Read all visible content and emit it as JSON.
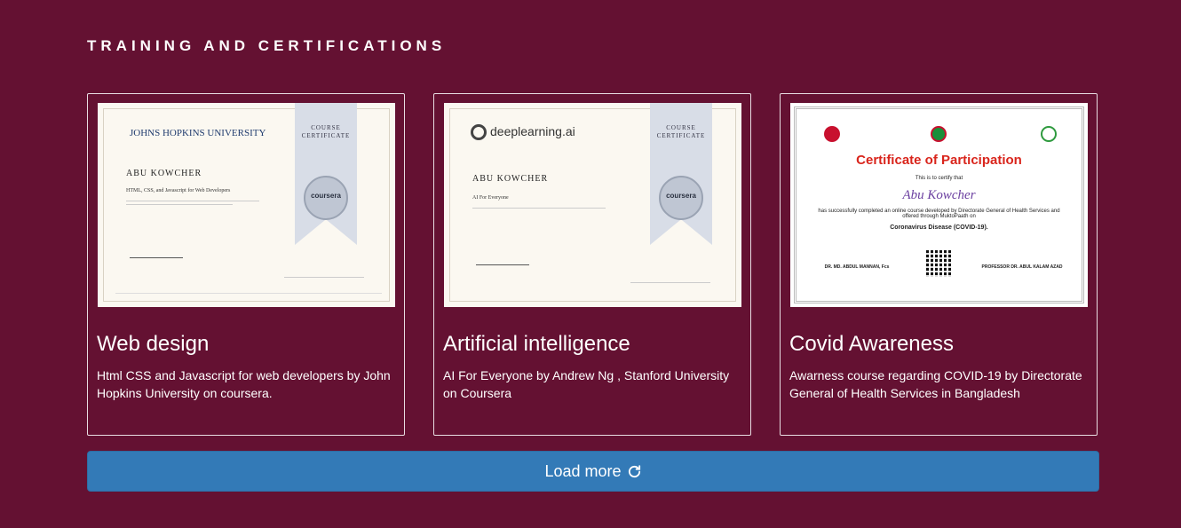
{
  "section": {
    "title": "TRAINING AND CERTIFICATIONS"
  },
  "cards": [
    {
      "title": "Web design",
      "description": "Html CSS and Javascript for web developers by John Hopkins University on coursera.",
      "certificate": {
        "brand": "JOHNS HOPKINS UNIVERSITY",
        "badge": "COURSE CERTIFICATE",
        "seal": "coursera",
        "name": "ABU KOWCHER",
        "course": "HTML, CSS, and Javascript for Web Developers"
      }
    },
    {
      "title": "Artificial intelligence",
      "description": "AI For Everyone by Andrew Ng , Stanford University on Coursera",
      "certificate": {
        "brand": "deeplearning.ai",
        "badge": "COURSE CERTIFICATE",
        "seal": "coursera",
        "name": "ABU KOWCHER",
        "course": "AI For Everyone"
      }
    },
    {
      "title": "Covid Awareness",
      "description": "Awarness course regarding COVID-19 by Directorate General of Health Services in Bangladesh",
      "certificate": {
        "heading": "Certificate of Participation",
        "certify": "This is to certify that",
        "name": "Abu Kowcher",
        "body": "has successfully completed an online course developed by Directorate General of Health Services and offered through MuktoPaath on",
        "course": "Coronavirus Disease (COVID-19).",
        "signer_left": "DR. MD. ABDUL MANNAN, Fcs",
        "signer_right": "PROFESSOR DR. ABUL KALAM AZAD"
      }
    }
  ],
  "load_more": {
    "label": "Load more",
    "icon": "refresh-icon"
  }
}
